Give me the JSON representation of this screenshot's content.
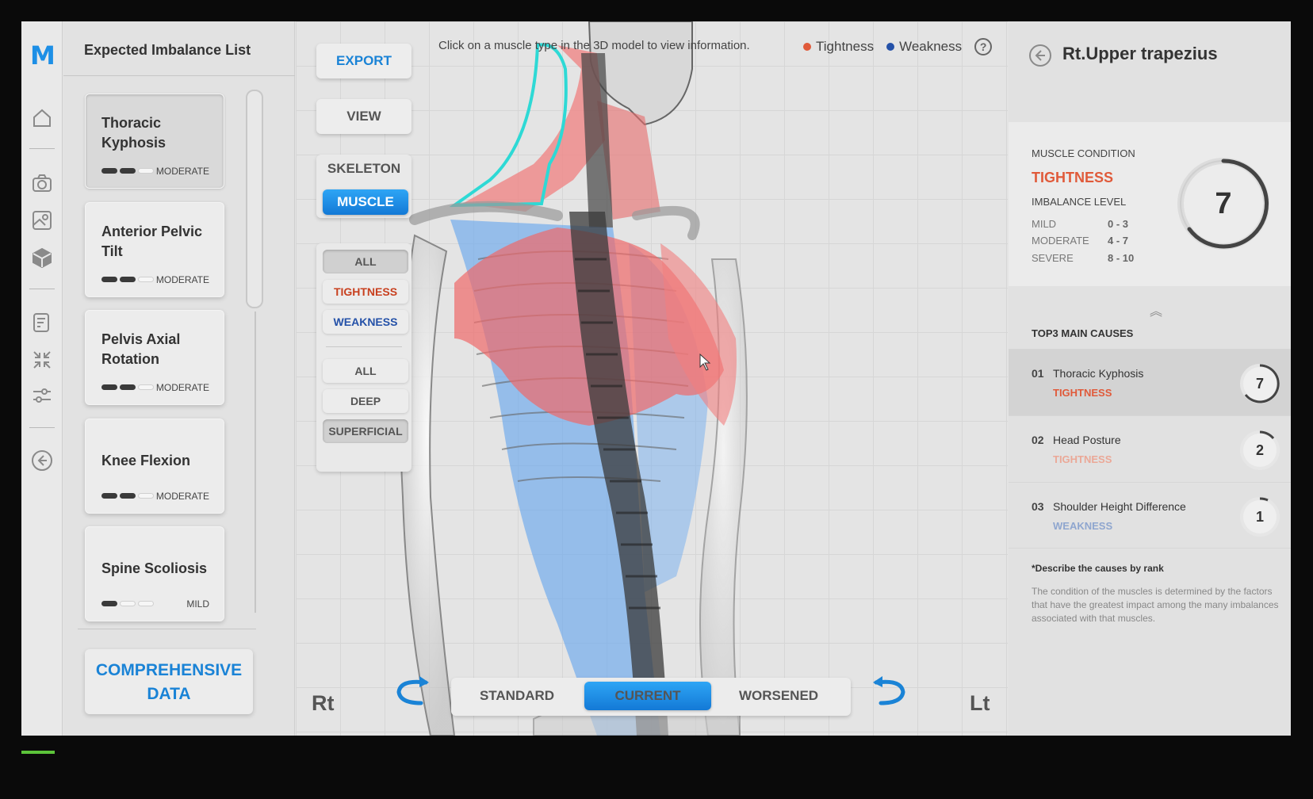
{
  "rail": {
    "logo": "M",
    "items": [
      "home-icon",
      "camera-icon",
      "photo-icon",
      "cube-icon",
      "report-icon",
      "compress-icon",
      "sliders-icon",
      "back-icon"
    ]
  },
  "list": {
    "title": "Expected Imbalance List",
    "items": [
      {
        "name": "Thoracic Kyphosis",
        "level": "MODERATE",
        "bars": 2
      },
      {
        "name": "Anterior Pelvic Tilt",
        "level": "MODERATE",
        "bars": 2
      },
      {
        "name": "Pelvis Axial Rotation",
        "level": "MODERATE",
        "bars": 2
      },
      {
        "name": "Knee Flexion",
        "level": "MODERATE",
        "bars": 2
      },
      {
        "name": "Spine Scoliosis",
        "level": "MILD",
        "bars": 1
      }
    ],
    "comprehensive_line1": "COMPREHENSIVE",
    "comprehensive_line2": "DATA"
  },
  "controls": {
    "export": "EXPORT",
    "view": "VIEW",
    "skeleton": "SKELETON",
    "muscle": "MUSCLE",
    "filter_all": "ALL",
    "tightness": "TIGHTNESS",
    "weakness": "WEAKNESS",
    "depth_all": "ALL",
    "deep": "DEEP",
    "superficial": "SUPERFICIAL"
  },
  "viewer": {
    "hint": "Click on a muscle type in the 3D model to view information.",
    "legend_tightness": "Tightness",
    "legend_weakness": "Weakness",
    "help": "?",
    "rt": "Rt",
    "lt": "Lt",
    "modes": [
      "STANDARD",
      "CURRENT",
      "WORSENED"
    ]
  },
  "detail": {
    "title": "Rt.Upper trapezius",
    "muscle_condition_label": "MUSCLE CONDITION",
    "condition": "TIGHTNESS",
    "imbalance_level_label": "IMBALANCE LEVEL",
    "levels": [
      {
        "name": "MILD",
        "range": "0 - 3"
      },
      {
        "name": "MODERATE",
        "range": "4 - 7"
      },
      {
        "name": "SEVERE",
        "range": "8 - 10"
      }
    ],
    "score": "7",
    "causes_title": "TOP3 MAIN CAUSES",
    "causes": [
      {
        "rank": "01",
        "name": "Thoracic Kyphosis",
        "condition": "TIGHTNESS",
        "score": "7"
      },
      {
        "rank": "02",
        "name": "Head Posture",
        "condition": "TIGHTNESS",
        "score": "2"
      },
      {
        "rank": "03",
        "name": "Shoulder Height Difference",
        "condition": "WEAKNESS",
        "score": "1"
      }
    ],
    "note_title": "*Describe the causes by rank",
    "note_body": "The condition of the muscles is determined by the factors that have the greatest impact among the many imbalances associated with that muscles."
  },
  "colors": {
    "accent": "#1a83d6",
    "tightness": "#e05a3a",
    "weakness": "#2451a8",
    "tightness_faded": "#eba897",
    "weakness_faded": "#8fa6cf"
  }
}
